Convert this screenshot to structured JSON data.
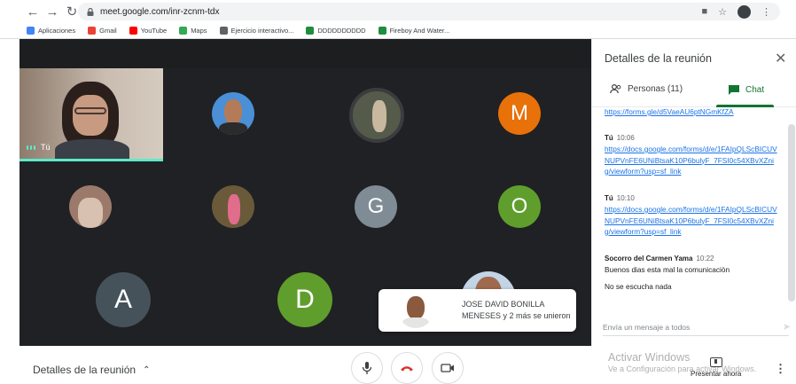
{
  "browser": {
    "url": "meet.google.com/inr-zcnm-tdx",
    "bookmarks": [
      {
        "label": "Aplicaciones",
        "color": "#4285f4"
      },
      {
        "label": "Gmail",
        "color": "#ea4335"
      },
      {
        "label": "YouTube",
        "color": "#ff0000"
      },
      {
        "label": "Maps",
        "color": "#34a853"
      },
      {
        "label": "Ejercicio interactivo...",
        "color": "#5f6368"
      },
      {
        "label": "DDDDDDDDDD",
        "color": "#1e8e3e"
      },
      {
        "label": "Fireboy And Water...",
        "color": "#1e8e3e"
      }
    ]
  },
  "grid": {
    "self_label": "Tú",
    "participants": [
      {
        "type": "photo",
        "bg": "#4b8fd6"
      },
      {
        "type": "photo",
        "bg": "#5f6b4f"
      },
      {
        "type": "letter",
        "letter": "M",
        "color": "#e8710a"
      },
      {
        "type": "photo",
        "bg": "#9c7a6b"
      },
      {
        "type": "photo",
        "bg": "#6a5a3a"
      },
      {
        "type": "letter",
        "letter": "G",
        "color": "#7f8c95"
      },
      {
        "type": "letter",
        "letter": "O",
        "color": "#5f9e2c"
      },
      {
        "type": "letter",
        "letter": "A",
        "color": "#46525a"
      },
      {
        "type": "letter",
        "letter": "D",
        "color": "#5f9e2c"
      }
    ]
  },
  "toast": {
    "line1": "JOSE DAVID BONILLA",
    "line2": "MENESES y 2 más se unieron"
  },
  "bottom": {
    "details_label": "Detalles de la reunión",
    "present_label": "Presentar ahora",
    "watermark_title": "Activar Windows",
    "watermark_sub": "Ve a Configuración para activar Windows."
  },
  "side_panel": {
    "title": "Detalles de la reunión",
    "tab_people": "Personas (11)",
    "tab_chat": "Chat",
    "input_placeholder": "Envía un mensaje a todos",
    "messages": [
      {
        "link": "https://forms.gle/d5VaeAU6ptNGmKfZA"
      },
      {
        "sender": "Tú",
        "time": "10:06",
        "link": "https://docs.google.com/forms/d/e/1FAIpQLScBICUVNUPVnFE6UNiBtsaK10P6bulyF_7FSI0c54XBvXZnig/viewform?usp=sf_link"
      },
      {
        "sender": "Tú",
        "time": "10:10",
        "link": "https://docs.google.com/forms/d/e/1FAIpQLScBICUVNUPVnFE6UNiBtsaK10P6bulyF_7FSI0c54XBvXZnig/viewform?usp=sf_link"
      },
      {
        "sender": "Socorro del Carmen Yama",
        "time": "10:22",
        "text": "Buenos dias esta mal la comunicaciòn"
      },
      {
        "text": "No se escucha nada"
      }
    ]
  }
}
